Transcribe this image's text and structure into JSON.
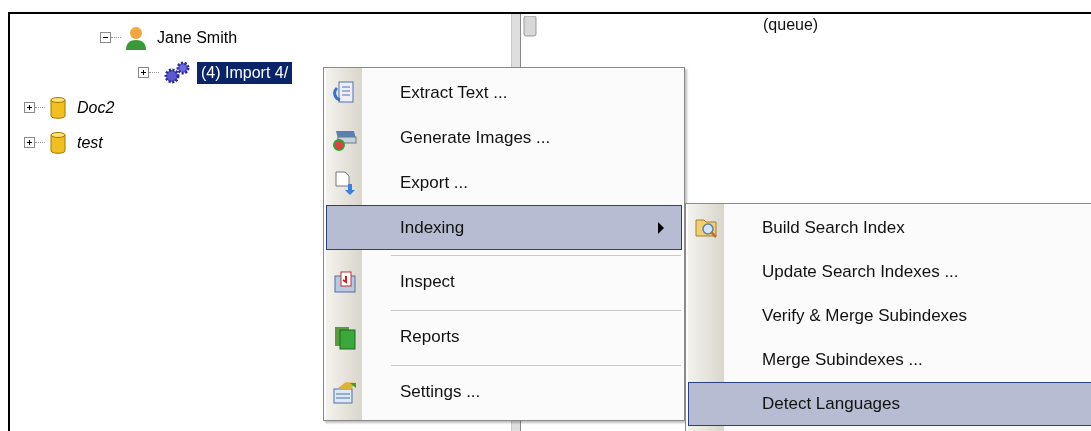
{
  "tree": [
    {
      "kind": "offscreen",
      "children": [
        {
          "kind": "offscreen",
          "children": [
            {
              "kind": "user",
              "label": "Jane Smith",
              "expanded": true,
              "selected": false,
              "children": [
                {
                  "kind": "job",
                  "label": "(4) Import 4/",
                  "expanded": false,
                  "selected": true
                }
              ]
            }
          ]
        }
      ]
    },
    {
      "kind": "database",
      "label": "Doc2",
      "expanded": false,
      "selected": false
    },
    {
      "kind": "database",
      "label": "test",
      "expanded": false,
      "selected": false
    }
  ],
  "list": {
    "cells": [
      "(queue)"
    ]
  },
  "context_menu": {
    "items": [
      {
        "label": "Extract Text ...",
        "selected": false,
        "separator_before": false,
        "has_submenu": false
      },
      {
        "label": "Generate Images ...",
        "selected": false,
        "separator_before": false,
        "has_submenu": false
      },
      {
        "label": "Export ...",
        "selected": false,
        "separator_before": false,
        "has_submenu": false
      },
      {
        "label": "Indexing",
        "selected": true,
        "separator_before": false,
        "has_submenu": true
      },
      {
        "label": "Inspect",
        "selected": false,
        "separator_before": true,
        "has_submenu": false
      },
      {
        "label": "Reports",
        "selected": false,
        "separator_before": true,
        "has_submenu": false
      },
      {
        "label": "Settings ...",
        "selected": false,
        "separator_before": true,
        "has_submenu": false
      }
    ]
  },
  "submenu": {
    "items": [
      {
        "label": "Build Search Index",
        "selected": false
      },
      {
        "label": "Update Search Indexes ...",
        "selected": false
      },
      {
        "label": "Verify & Merge Subindexes",
        "selected": false
      },
      {
        "label": "Merge Subindexes ...",
        "selected": false
      },
      {
        "label": "Detect Languages",
        "selected": true
      }
    ]
  }
}
